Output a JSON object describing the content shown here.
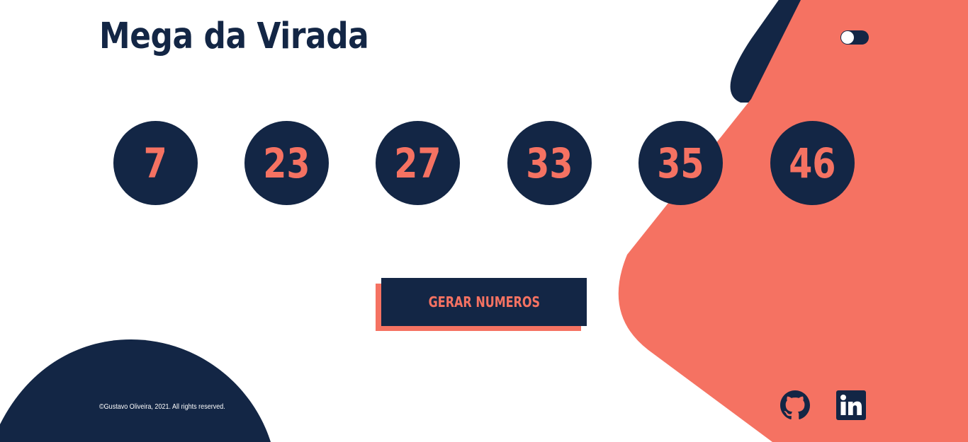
{
  "app": {
    "title": "Mega da Virada"
  },
  "theme_toggle": {
    "state": "off"
  },
  "numbers": [
    "7",
    "23",
    "27",
    "33",
    "35",
    "46"
  ],
  "action": {
    "generate_label": "GERAR NUMEROS"
  },
  "footer": {
    "copyright": "©Gustavo Oliveira, 2021. All rights reserved."
  },
  "social": {
    "github_icon": "github-icon",
    "linkedin_icon": "linkedin-icon"
  },
  "colors": {
    "navy": "#132645",
    "coral": "#F57262",
    "background": "#FFFFFF"
  }
}
